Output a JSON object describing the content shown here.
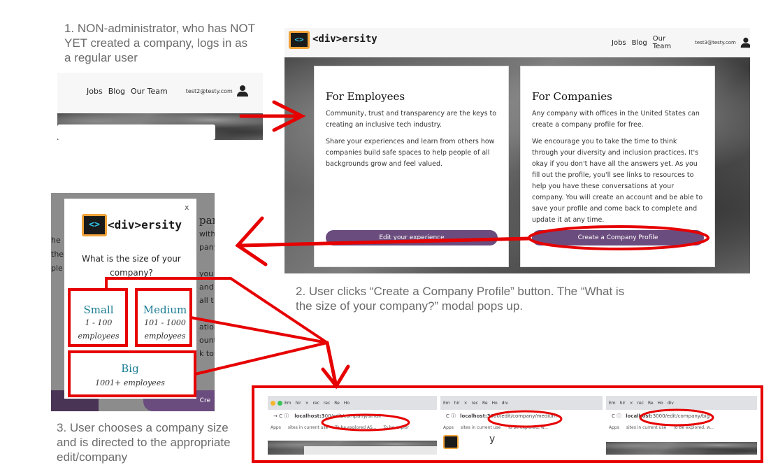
{
  "captions": {
    "step1": "1. NON-administrator, who has NOT YET created a company, logs in as a regular user",
    "step2": "2. User clicks “Create a Company Profile” button. The “What is the size of your company?” modal pops up.",
    "step3": "3. User chooses a company size and is directed to the appropriate edit/company"
  },
  "navbar": {
    "jobs": "Jobs",
    "blog": "Blog",
    "our_team": "Our Team",
    "email_step1": "test2@testy.com",
    "email_step2": "test3@testy.com"
  },
  "logo": {
    "mark": "<>",
    "text": "<div>ersity"
  },
  "employees_card": {
    "title": "For Employees",
    "p1": "Community, trust and transparency are the keys to creating an inclusive tech industry.",
    "p2": "Share your experiences and learn from others how companies build safe spaces to help people of all backgrounds grow and feel valued.",
    "button": "Edit your experience"
  },
  "companies_card": {
    "title": "For Companies",
    "p1": "Any company with offices in the United States can create a company profile for free.",
    "p2": "We encourage you to take the time to think through your diversity and inclusion practices. It's okay if you don't have all the answers yet. As you fill out the profile, you'll see links to resources to help you have these conversations at your company. You will create an account and be able to save your profile and come back to complete and update it at any time.",
    "button": "Create a Company Profile"
  },
  "modal": {
    "close": "x",
    "question": "What is the size of your company?",
    "small_title": "Small",
    "small_range": "1 - 100",
    "small_unit": "employees",
    "medium_title": "Medium",
    "medium_range": "101 - 1000",
    "medium_unit": "employees",
    "big_title": "Big",
    "big_range": "1001+ employees",
    "peek_right": [
      "pan",
      "with",
      "pany",
      "",
      "you",
      "and",
      "all t",
      "",
      "ation",
      "ount",
      "k to"
    ],
    "peek_left": [
      "he",
      "",
      "the",
      "ple"
    ],
    "peek_button": "Cre"
  },
  "browsers": [
    {
      "url_prefix": "localhost:3",
      "url_rest": "00/edit/company/small",
      "bookmark3": "To be explored AS...",
      "bookmark4": "To be explor"
    },
    {
      "url_prefix": "localhost:3",
      "url_rest": "000/edit/company/medium",
      "bookmark3": "To be explored, w...",
      "bookmark4": ""
    },
    {
      "url_prefix": "localhost:",
      "url_rest": "3000/edit/company/big",
      "bookmark3": "To be explored, w...",
      "bookmark4": ""
    }
  ],
  "browser_chrome": {
    "apps": "Apps",
    "sites": "sites in current use",
    "tabs": [
      "Em",
      "hir",
      "rec",
      "rec",
      "Re",
      "Ho",
      "div"
    ]
  },
  "colors": {
    "annotation_red": "#e60000",
    "button_purple": "#6b4c7e",
    "size_teal": "#1c7d93",
    "logo_orange": "#f2a33a",
    "logo_cyan": "#2fc4e8"
  }
}
